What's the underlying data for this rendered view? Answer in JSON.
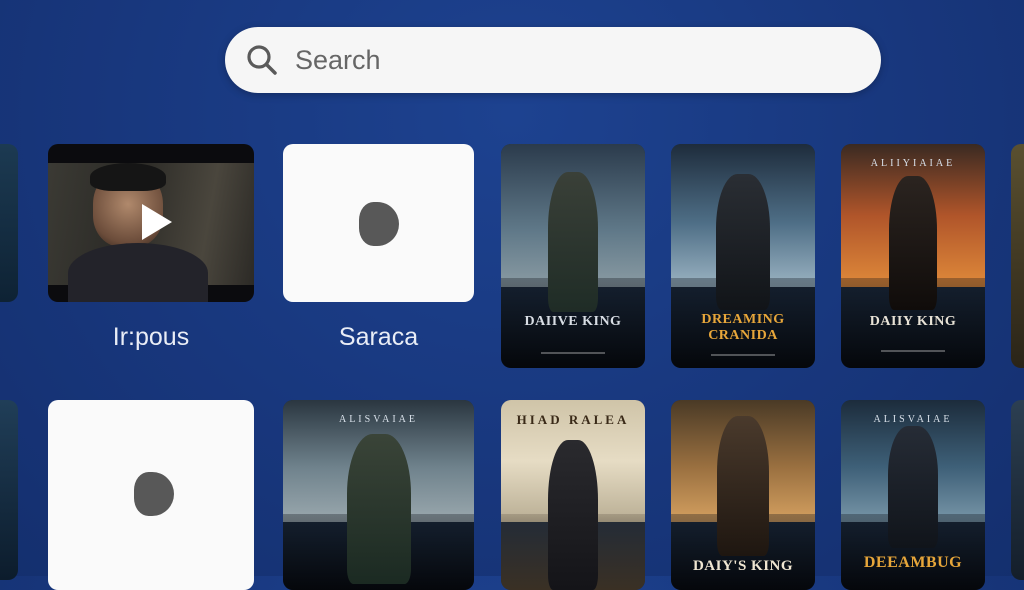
{
  "search": {
    "placeholder": "Search"
  },
  "row1": {
    "video_label": "Ir:pous",
    "placeholder_label": "Saraca",
    "posters": [
      {
        "top": "",
        "title": "DAIIVE KING",
        "title_color": "#d8dde4"
      },
      {
        "top": "",
        "title": "DREAMING CRANIDA",
        "title_color": "#e7a63a"
      },
      {
        "top": "ALIIYIAIAE",
        "title": "DAIIY KING",
        "title_color": "#e8e2d6"
      }
    ]
  },
  "row2": {
    "posters": [
      {
        "top": "ALISVAIAE",
        "title": "",
        "title_color": "#d8dde4"
      },
      {
        "top": "HIAD RALEA",
        "title": "",
        "title_color": "#3a2a18"
      },
      {
        "top": "",
        "title": "DAIY'S KING",
        "title_color": "#f0e6d2"
      },
      {
        "top": "ALISVAIAE",
        "title": "DEEAMBUG",
        "title_color": "#e7a63a"
      }
    ]
  },
  "colors": {
    "background": "#18377d",
    "search_bg": "#f6f6f6"
  },
  "icons": {
    "search": "search-icon",
    "play": "play-icon"
  }
}
